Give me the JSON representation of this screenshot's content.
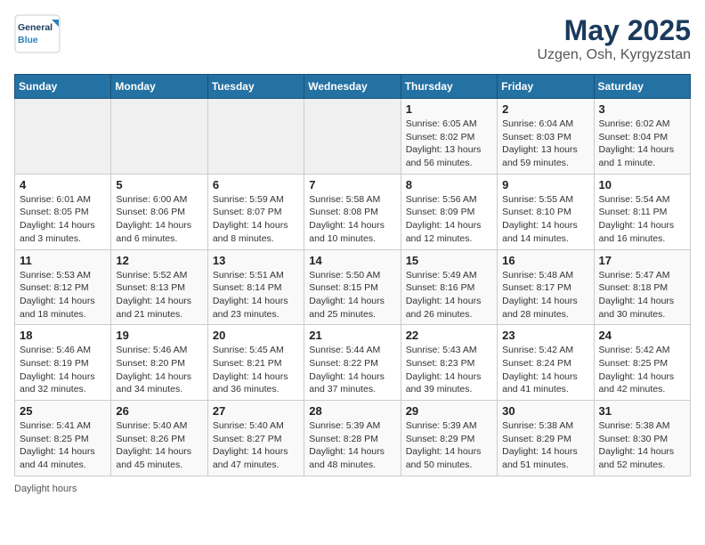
{
  "header": {
    "logo_line1": "General",
    "logo_line2": "Blue",
    "title": "May 2025",
    "subtitle": "Uzgen, Osh, Kyrgyzstan"
  },
  "days_of_week": [
    "Sunday",
    "Monday",
    "Tuesday",
    "Wednesday",
    "Thursday",
    "Friday",
    "Saturday"
  ],
  "weeks": [
    [
      {
        "day": "",
        "info": ""
      },
      {
        "day": "",
        "info": ""
      },
      {
        "day": "",
        "info": ""
      },
      {
        "day": "",
        "info": ""
      },
      {
        "day": "1",
        "info": "Sunrise: 6:05 AM\nSunset: 8:02 PM\nDaylight: 13 hours and 56 minutes."
      },
      {
        "day": "2",
        "info": "Sunrise: 6:04 AM\nSunset: 8:03 PM\nDaylight: 13 hours and 59 minutes."
      },
      {
        "day": "3",
        "info": "Sunrise: 6:02 AM\nSunset: 8:04 PM\nDaylight: 14 hours and 1 minute."
      }
    ],
    [
      {
        "day": "4",
        "info": "Sunrise: 6:01 AM\nSunset: 8:05 PM\nDaylight: 14 hours and 3 minutes."
      },
      {
        "day": "5",
        "info": "Sunrise: 6:00 AM\nSunset: 8:06 PM\nDaylight: 14 hours and 6 minutes."
      },
      {
        "day": "6",
        "info": "Sunrise: 5:59 AM\nSunset: 8:07 PM\nDaylight: 14 hours and 8 minutes."
      },
      {
        "day": "7",
        "info": "Sunrise: 5:58 AM\nSunset: 8:08 PM\nDaylight: 14 hours and 10 minutes."
      },
      {
        "day": "8",
        "info": "Sunrise: 5:56 AM\nSunset: 8:09 PM\nDaylight: 14 hours and 12 minutes."
      },
      {
        "day": "9",
        "info": "Sunrise: 5:55 AM\nSunset: 8:10 PM\nDaylight: 14 hours and 14 minutes."
      },
      {
        "day": "10",
        "info": "Sunrise: 5:54 AM\nSunset: 8:11 PM\nDaylight: 14 hours and 16 minutes."
      }
    ],
    [
      {
        "day": "11",
        "info": "Sunrise: 5:53 AM\nSunset: 8:12 PM\nDaylight: 14 hours and 18 minutes."
      },
      {
        "day": "12",
        "info": "Sunrise: 5:52 AM\nSunset: 8:13 PM\nDaylight: 14 hours and 21 minutes."
      },
      {
        "day": "13",
        "info": "Sunrise: 5:51 AM\nSunset: 8:14 PM\nDaylight: 14 hours and 23 minutes."
      },
      {
        "day": "14",
        "info": "Sunrise: 5:50 AM\nSunset: 8:15 PM\nDaylight: 14 hours and 25 minutes."
      },
      {
        "day": "15",
        "info": "Sunrise: 5:49 AM\nSunset: 8:16 PM\nDaylight: 14 hours and 26 minutes."
      },
      {
        "day": "16",
        "info": "Sunrise: 5:48 AM\nSunset: 8:17 PM\nDaylight: 14 hours and 28 minutes."
      },
      {
        "day": "17",
        "info": "Sunrise: 5:47 AM\nSunset: 8:18 PM\nDaylight: 14 hours and 30 minutes."
      }
    ],
    [
      {
        "day": "18",
        "info": "Sunrise: 5:46 AM\nSunset: 8:19 PM\nDaylight: 14 hours and 32 minutes."
      },
      {
        "day": "19",
        "info": "Sunrise: 5:46 AM\nSunset: 8:20 PM\nDaylight: 14 hours and 34 minutes."
      },
      {
        "day": "20",
        "info": "Sunrise: 5:45 AM\nSunset: 8:21 PM\nDaylight: 14 hours and 36 minutes."
      },
      {
        "day": "21",
        "info": "Sunrise: 5:44 AM\nSunset: 8:22 PM\nDaylight: 14 hours and 37 minutes."
      },
      {
        "day": "22",
        "info": "Sunrise: 5:43 AM\nSunset: 8:23 PM\nDaylight: 14 hours and 39 minutes."
      },
      {
        "day": "23",
        "info": "Sunrise: 5:42 AM\nSunset: 8:24 PM\nDaylight: 14 hours and 41 minutes."
      },
      {
        "day": "24",
        "info": "Sunrise: 5:42 AM\nSunset: 8:25 PM\nDaylight: 14 hours and 42 minutes."
      }
    ],
    [
      {
        "day": "25",
        "info": "Sunrise: 5:41 AM\nSunset: 8:25 PM\nDaylight: 14 hours and 44 minutes."
      },
      {
        "day": "26",
        "info": "Sunrise: 5:40 AM\nSunset: 8:26 PM\nDaylight: 14 hours and 45 minutes."
      },
      {
        "day": "27",
        "info": "Sunrise: 5:40 AM\nSunset: 8:27 PM\nDaylight: 14 hours and 47 minutes."
      },
      {
        "day": "28",
        "info": "Sunrise: 5:39 AM\nSunset: 8:28 PM\nDaylight: 14 hours and 48 minutes."
      },
      {
        "day": "29",
        "info": "Sunrise: 5:39 AM\nSunset: 8:29 PM\nDaylight: 14 hours and 50 minutes."
      },
      {
        "day": "30",
        "info": "Sunrise: 5:38 AM\nSunset: 8:29 PM\nDaylight: 14 hours and 51 minutes."
      },
      {
        "day": "31",
        "info": "Sunrise: 5:38 AM\nSunset: 8:30 PM\nDaylight: 14 hours and 52 minutes."
      }
    ]
  ],
  "footer": {
    "note": "Daylight hours"
  }
}
